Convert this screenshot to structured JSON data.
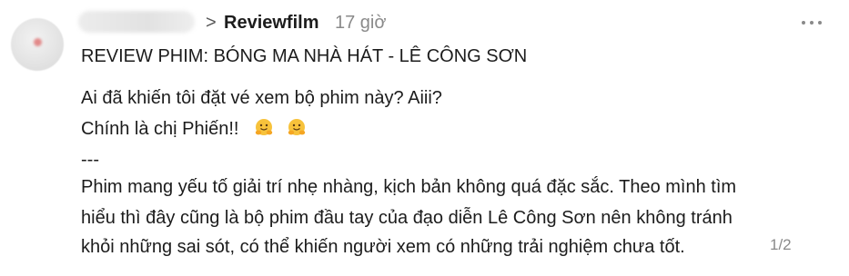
{
  "header": {
    "chevron": ">",
    "group_name": "Reviewfilm",
    "time": "17 giờ"
  },
  "post": {
    "title": "REVIEW PHIM: BÓNG MA NHÀ HÁT - LÊ CÔNG SƠN",
    "line1": "Ai đã khiến tôi đặt vé xem bộ phim này? Aiii?",
    "line2": "Chính là chị Phiến!!",
    "separator": "---",
    "paragraph": [
      "Phim mang yếu tố giải trí nhẹ nhàng, kịch bản không quá đặc sắc. Theo mình tìm",
      "hiểu thì đây cũng là bộ phim đầu tay của đạo diễn Lê Công Sơn nên không tránh",
      "khỏi những sai sót, có thể khiến người xem có những trải nghiệm chưa tốt."
    ],
    "emojis": [
      "hugging-face-emoji",
      "hugging-face-emoji"
    ],
    "page_indicator": "1/2"
  },
  "icons": {
    "more": "more-options-icon"
  }
}
